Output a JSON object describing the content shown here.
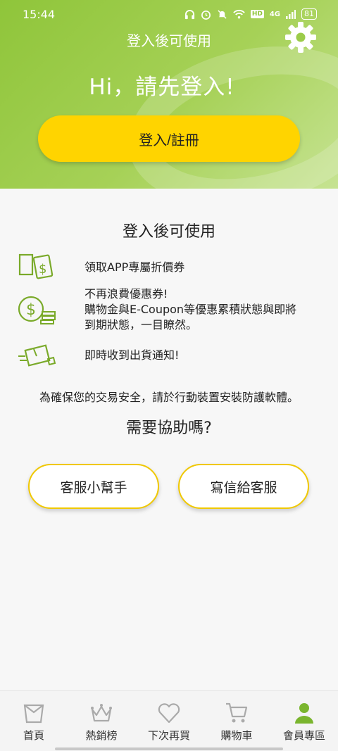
{
  "status_bar": {
    "time": "15:44",
    "hd": "HD",
    "network": "4G",
    "battery": "81",
    "icons": [
      "headphones-icon",
      "alarm-icon",
      "mute-icon",
      "wifi-icon",
      "signal-icon",
      "battery-icon"
    ]
  },
  "header": {
    "title": "登入後可使用",
    "greeting": "Hi，請先登入!",
    "login_button": "登入/註冊",
    "settings_icon": "gear-icon"
  },
  "benefits": {
    "title": "登入後可使用",
    "items": [
      {
        "icon": "coupon-icon",
        "lines": [
          "領取APP專屬折價券"
        ]
      },
      {
        "icon": "money-coins-icon",
        "lines": [
          "不再浪費優惠券!",
          "購物金與E-Coupon等優惠累積狀態與即將",
          "到期狀態，一目瞭然。"
        ]
      },
      {
        "icon": "delivery-box-icon",
        "lines": [
          "即時收到出貨通知!"
        ]
      }
    ]
  },
  "security_note": "為確保您的交易安全，請於行動裝置安裝防護軟體。",
  "help": {
    "title": "需要協助嗎?",
    "assistant_button": "客服小幫手",
    "email_button": "寫信給客服"
  },
  "tabbar": {
    "items": [
      {
        "label": "首頁",
        "icon": "home-bag-icon"
      },
      {
        "label": "熱銷榜",
        "icon": "crown-icon"
      },
      {
        "label": "下次再買",
        "icon": "heart-icon"
      },
      {
        "label": "購物車",
        "icon": "cart-icon"
      },
      {
        "label": "會員專區",
        "icon": "member-icon"
      }
    ],
    "active_index": 4
  },
  "colors": {
    "brand_green": "#8fc53a",
    "brand_yellow": "#ffd400",
    "icon_green": "#7aaa2a"
  }
}
